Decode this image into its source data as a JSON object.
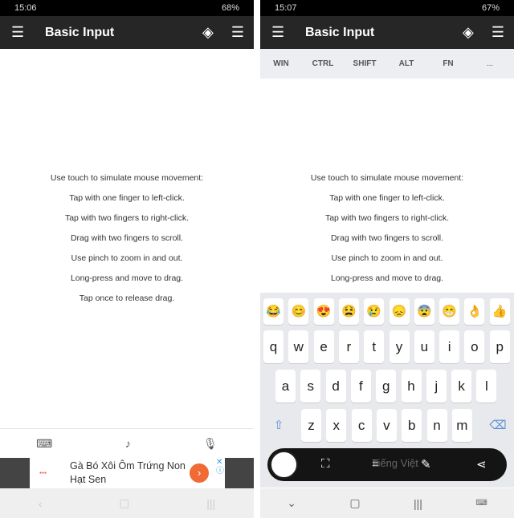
{
  "left": {
    "status": {
      "time": "15:06",
      "battery": "68%"
    },
    "title": "Basic Input",
    "instructions": [
      "Use touch to simulate mouse movement:",
      "Tap with one finger to left-click.",
      "Tap with two fingers to right-click.",
      "Drag with two fingers to scroll.",
      "Use pinch to zoom in and out.",
      "Long-press and move to drag.",
      "Tap once to release drag."
    ],
    "bottom_icons": [
      "keyboard-icon",
      "music-note-icon",
      "microphone-icon"
    ],
    "ad": {
      "text": "Gà Bó Xôi Ôm Trứng Non Hạt Sen",
      "brand_color": "#ef6a35"
    }
  },
  "right": {
    "status": {
      "time": "15:07",
      "battery": "67%"
    },
    "title": "Basic Input",
    "modifiers": [
      "WIN",
      "CTRL",
      "SHIFT",
      "ALT",
      "FN",
      "..."
    ],
    "instructions": [
      "Use touch to simulate mouse movement:",
      "Tap with one finger to left-click.",
      "Tap with two fingers to right-click.",
      "Drag with two fingers to scroll.",
      "Use pinch to zoom in and out.",
      "Long-press and move to drag."
    ],
    "emoji": [
      "😂",
      "😊",
      "😍",
      "😫",
      "😢",
      "😞",
      "😨",
      "😁",
      "👌",
      "👍"
    ],
    "rows": [
      [
        "q",
        "w",
        "e",
        "r",
        "t",
        "y",
        "u",
        "i",
        "o",
        "p"
      ],
      [
        "a",
        "s",
        "d",
        "f",
        "g",
        "h",
        "j",
        "k",
        "l"
      ],
      [
        "z",
        "x",
        "c",
        "v",
        "b",
        "n",
        "m"
      ]
    ],
    "language": "Tiếng Việt"
  }
}
